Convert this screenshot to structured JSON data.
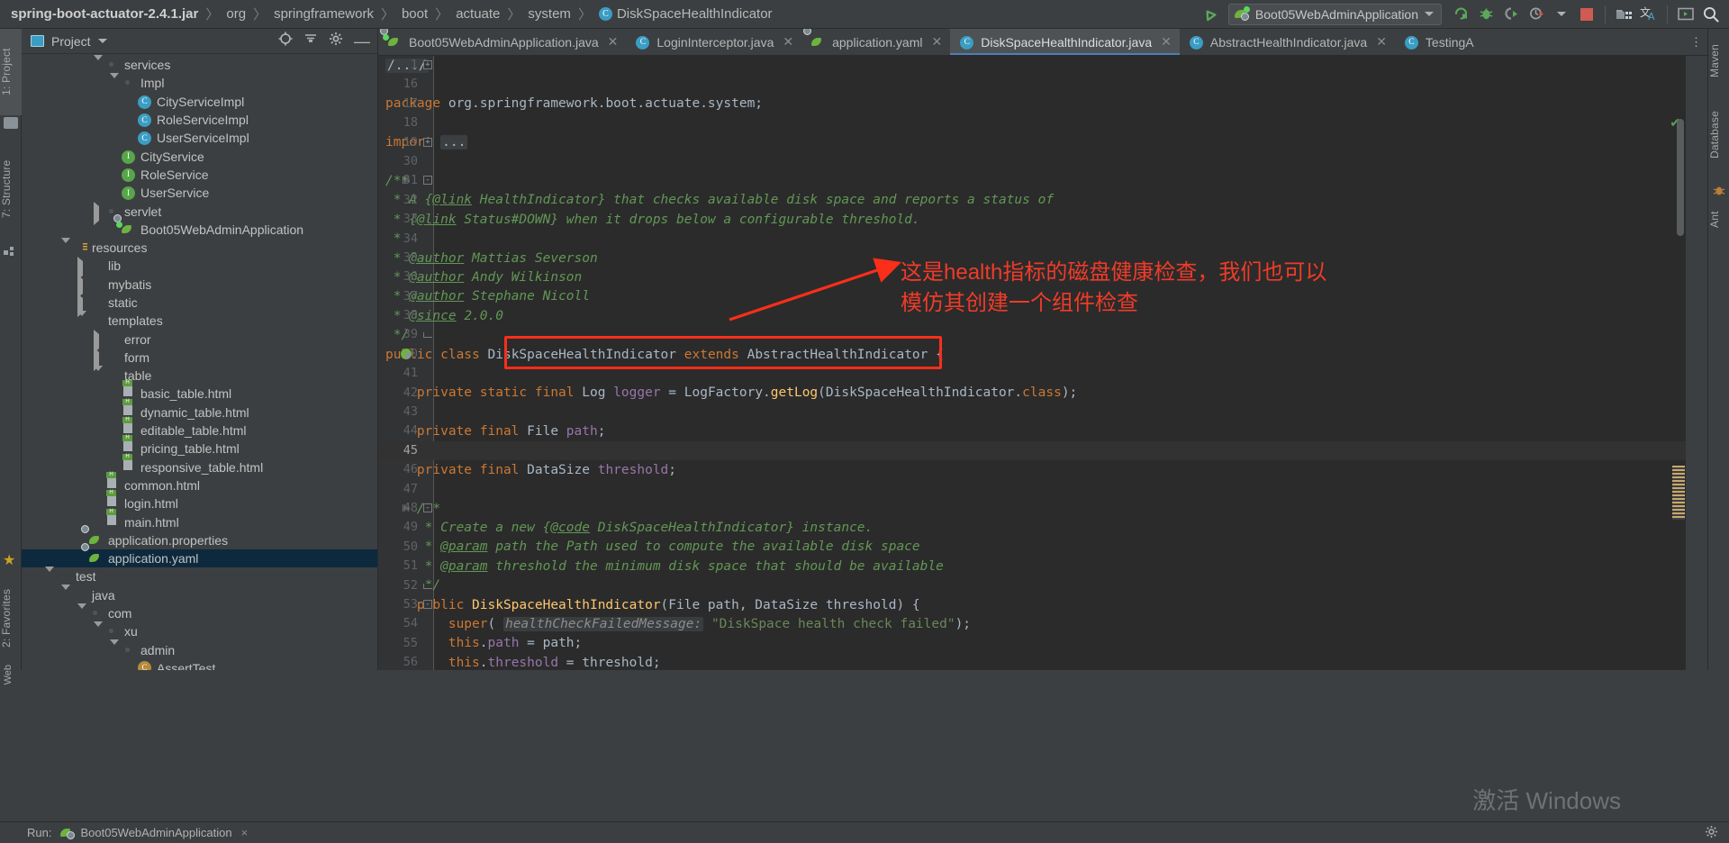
{
  "topbar": {
    "breadcrumbs": [
      {
        "label": "spring-boot-actuator-2.4.1.jar",
        "icon": "",
        "bold": true
      },
      {
        "label": "org",
        "icon": ""
      },
      {
        "label": "springframework",
        "icon": ""
      },
      {
        "label": "boot",
        "icon": ""
      },
      {
        "label": "actuate",
        "icon": ""
      },
      {
        "label": "system",
        "icon": ""
      },
      {
        "label": "DiskSpaceHealthIndicator",
        "icon": "class-icon"
      }
    ],
    "run_config": "Boot05WebAdminApplication",
    "icons": [
      "build-icon",
      "run-icon",
      "debug-icon",
      "run-coverage-icon",
      "profiler-icon",
      "stop-icon",
      "project-structure-icon",
      "translate-icon",
      "terminal-icon",
      "search-everywhere-icon"
    ]
  },
  "left_tool_strip": {
    "tabs": [
      "1: Project",
      "7: Structure"
    ],
    "active": "1: Project",
    "bottom_tabs": [
      "2: Favorites"
    ]
  },
  "right_tool_strip": {
    "tabs": [
      "Maven",
      "Database",
      "Ant"
    ]
  },
  "project_panel": {
    "title": "Project",
    "tree": [
      {
        "depth": 4,
        "twisty": "down",
        "icon": "folder-pkg",
        "label": "services"
      },
      {
        "depth": 5,
        "twisty": "down",
        "icon": "folder-pkg",
        "label": "Impl"
      },
      {
        "depth": 6,
        "twisty": "none",
        "icon": "class",
        "label": "CityServiceImpl"
      },
      {
        "depth": 6,
        "twisty": "none",
        "icon": "class",
        "label": "RoleServiceImpl"
      },
      {
        "depth": 6,
        "twisty": "none",
        "icon": "class",
        "label": "UserServiceImpl"
      },
      {
        "depth": 5,
        "twisty": "none",
        "icon": "interface",
        "label": "CityService"
      },
      {
        "depth": 5,
        "twisty": "none",
        "icon": "interface",
        "label": "RoleService"
      },
      {
        "depth": 5,
        "twisty": "none",
        "icon": "interface",
        "label": "UserService"
      },
      {
        "depth": 4,
        "twisty": "right",
        "icon": "folder-pkg",
        "label": "servlet"
      },
      {
        "depth": 5,
        "twisty": "none",
        "icon": "spring-boot",
        "label": "Boot05WebAdminApplication"
      },
      {
        "depth": 2,
        "twisty": "down",
        "icon": "folder-res",
        "label": "resources"
      },
      {
        "depth": 3,
        "twisty": "right",
        "icon": "folder",
        "label": "lib"
      },
      {
        "depth": 3,
        "twisty": "right",
        "icon": "folder",
        "label": "mybatis"
      },
      {
        "depth": 3,
        "twisty": "right",
        "icon": "folder",
        "label": "static"
      },
      {
        "depth": 3,
        "twisty": "down",
        "icon": "folder",
        "label": "templates"
      },
      {
        "depth": 4,
        "twisty": "right",
        "icon": "folder",
        "label": "error"
      },
      {
        "depth": 4,
        "twisty": "right",
        "icon": "folder",
        "label": "form"
      },
      {
        "depth": 4,
        "twisty": "down",
        "icon": "folder",
        "label": "table"
      },
      {
        "depth": 5,
        "twisty": "none",
        "icon": "html",
        "label": "basic_table.html"
      },
      {
        "depth": 5,
        "twisty": "none",
        "icon": "html",
        "label": "dynamic_table.html"
      },
      {
        "depth": 5,
        "twisty": "none",
        "icon": "html",
        "label": "editable_table.html"
      },
      {
        "depth": 5,
        "twisty": "none",
        "icon": "html",
        "label": "pricing_table.html"
      },
      {
        "depth": 5,
        "twisty": "none",
        "icon": "html",
        "label": "responsive_table.html"
      },
      {
        "depth": 4,
        "twisty": "none",
        "icon": "html",
        "label": "common.html"
      },
      {
        "depth": 4,
        "twisty": "none",
        "icon": "html",
        "label": "login.html"
      },
      {
        "depth": 4,
        "twisty": "none",
        "icon": "html",
        "label": "main.html"
      },
      {
        "depth": 3,
        "twisty": "none",
        "icon": "spring-prop",
        "label": "application.properties"
      },
      {
        "depth": 3,
        "twisty": "none",
        "icon": "spring-prop",
        "label": "application.yaml",
        "selected": true
      },
      {
        "depth": 1,
        "twisty": "down",
        "icon": "folder-test",
        "label": "test"
      },
      {
        "depth": 2,
        "twisty": "down",
        "icon": "folder-test",
        "label": "java"
      },
      {
        "depth": 3,
        "twisty": "down",
        "icon": "folder-pkg",
        "label": "com"
      },
      {
        "depth": 4,
        "twisty": "down",
        "icon": "folder-pkg",
        "label": "xu"
      },
      {
        "depth": 5,
        "twisty": "down",
        "icon": "folder-pkg",
        "label": "admin"
      },
      {
        "depth": 6,
        "twisty": "none",
        "icon": "test-class",
        "label": "AssertTest"
      }
    ]
  },
  "editor_tabs": [
    {
      "label": "Boot05WebAdminApplication.java",
      "icon": "spring-boot",
      "active": false,
      "closable": true
    },
    {
      "label": "LoginInterceptor.java",
      "icon": "class",
      "active": false,
      "closable": true
    },
    {
      "label": "application.yaml",
      "icon": "spring-prop",
      "active": false,
      "closable": true
    },
    {
      "label": "DiskSpaceHealthIndicator.java",
      "icon": "class",
      "active": true,
      "closable": true
    },
    {
      "label": "AbstractHealthIndicator.java",
      "icon": "class",
      "active": false,
      "closable": true
    },
    {
      "label": "TestingA",
      "icon": "class",
      "active": false,
      "closable": false
    }
  ],
  "code": {
    "file": "DiskSpaceHealthIndicator.java",
    "lines": [
      {
        "num": "1",
        "fold": "+",
        "tokens": [
          {
            "t": "/.../",
            "c": "pill"
          }
        ]
      },
      {
        "num": "16",
        "tokens": []
      },
      {
        "num": "17",
        "tokens": [
          {
            "t": "package ",
            "c": "k"
          },
          {
            "t": "org.springframework.boot.actuate.system;",
            "c": "id"
          }
        ]
      },
      {
        "num": "18",
        "tokens": []
      },
      {
        "num": "19",
        "fold": "+",
        "tokens": [
          {
            "t": "import ",
            "c": "k"
          },
          {
            "t": "...",
            "c": "pill"
          }
        ]
      },
      {
        "num": "30",
        "tokens": []
      },
      {
        "num": "31",
        "fold": "-",
        "bookmark": true,
        "tokens": [
          {
            "t": "/**",
            "c": "c"
          }
        ]
      },
      {
        "num": "32",
        "tokens": [
          {
            "t": " * A {",
            "c": "c"
          },
          {
            "t": "@link",
            "c": "tag"
          },
          {
            "t": " HealthIndicator} that checks available disk space and reports a status of",
            "c": "c"
          }
        ]
      },
      {
        "num": "33",
        "tokens": [
          {
            "t": " * {",
            "c": "c"
          },
          {
            "t": "@link",
            "c": "tag"
          },
          {
            "t": " Status#DOWN} when it drops below a configurable threshold.",
            "c": "c"
          }
        ]
      },
      {
        "num": "34",
        "tokens": [
          {
            "t": " *",
            "c": "c"
          }
        ]
      },
      {
        "num": "35",
        "tokens": [
          {
            "t": " * ",
            "c": "c"
          },
          {
            "t": "@author",
            "c": "tag"
          },
          {
            "t": " Mattias Severson",
            "c": "c"
          }
        ]
      },
      {
        "num": "36",
        "tokens": [
          {
            "t": " * ",
            "c": "c"
          },
          {
            "t": "@author",
            "c": "tag"
          },
          {
            "t": " Andy Wilkinson",
            "c": "c"
          }
        ]
      },
      {
        "num": "37",
        "tokens": [
          {
            "t": " * ",
            "c": "c"
          },
          {
            "t": "@author",
            "c": "tag"
          },
          {
            "t": " Stephane Nicoll",
            "c": "c"
          }
        ]
      },
      {
        "num": "38",
        "tokens": [
          {
            "t": " * ",
            "c": "c"
          },
          {
            "t": "@since",
            "c": "tag"
          },
          {
            "t": " 2.0.0",
            "c": "c"
          }
        ]
      },
      {
        "num": "39",
        "fold": "e",
        "tokens": [
          {
            "t": " */",
            "c": "c"
          }
        ]
      },
      {
        "num": "40",
        "runmark": true,
        "tokens": [
          {
            "t": "public class ",
            "c": "k"
          },
          {
            "t": "DiskSpaceHealthIndicator ",
            "c": "id"
          },
          {
            "t": "extends ",
            "c": "k"
          },
          {
            "t": "AbstractHealthIndicator ",
            "c": "id"
          },
          {
            "t": "{",
            "c": "id"
          }
        ]
      },
      {
        "num": "41",
        "tokens": []
      },
      {
        "num": "42",
        "tokens": [
          {
            "t": "    private static final ",
            "c": "k"
          },
          {
            "t": "Log ",
            "c": "id"
          },
          {
            "t": "logger",
            "c": "fld"
          },
          {
            "t": " = LogFactory.",
            "c": "id"
          },
          {
            "t": "getLog",
            "c": "mth"
          },
          {
            "t": "(DiskSpaceHealthIndicator.",
            "c": "id"
          },
          {
            "t": "class",
            "c": "k"
          },
          {
            "t": ");",
            "c": "id"
          }
        ]
      },
      {
        "num": "43",
        "tokens": []
      },
      {
        "num": "44",
        "tokens": [
          {
            "t": "    private final ",
            "c": "k"
          },
          {
            "t": "File ",
            "c": "id"
          },
          {
            "t": "path",
            "c": "fld"
          },
          {
            "t": ";",
            "c": "id"
          }
        ]
      },
      {
        "num": "45",
        "current": true,
        "tokens": []
      },
      {
        "num": "46",
        "tokens": [
          {
            "t": "    private final ",
            "c": "k"
          },
          {
            "t": "DataSize ",
            "c": "id"
          },
          {
            "t": "threshold",
            "c": "fld"
          },
          {
            "t": ";",
            "c": "id"
          }
        ]
      },
      {
        "num": "47",
        "tokens": []
      },
      {
        "num": "48",
        "fold": "-",
        "bookmark": true,
        "tokens": [
          {
            "t": "    /**",
            "c": "c"
          }
        ]
      },
      {
        "num": "49",
        "tokens": [
          {
            "t": "     * Create a new {",
            "c": "c"
          },
          {
            "t": "@code",
            "c": "tag"
          },
          {
            "t": " DiskSpaceHealthIndicator} instance.",
            "c": "c"
          }
        ]
      },
      {
        "num": "50",
        "tokens": [
          {
            "t": "     * ",
            "c": "c"
          },
          {
            "t": "@param",
            "c": "tag"
          },
          {
            "t": " path the Path used to compute the available disk space",
            "c": "c"
          }
        ]
      },
      {
        "num": "51",
        "tokens": [
          {
            "t": "     * ",
            "c": "c"
          },
          {
            "t": "@param",
            "c": "tag"
          },
          {
            "t": " threshold the minimum disk space that should be available",
            "c": "c"
          }
        ]
      },
      {
        "num": "52",
        "fold": "e",
        "tokens": [
          {
            "t": "     */",
            "c": "c"
          }
        ]
      },
      {
        "num": "53",
        "fold": "-",
        "tokens": [
          {
            "t": "    public ",
            "c": "k"
          },
          {
            "t": "DiskSpaceHealthIndicator",
            "c": "mth"
          },
          {
            "t": "(File path, DataSize threshold) {",
            "c": "id"
          }
        ]
      },
      {
        "num": "54",
        "tokens": [
          {
            "t": "        super",
            "c": "k"
          },
          {
            "t": "( ",
            "c": "id"
          },
          {
            "t": "healthCheckFailedMessage:",
            "c": "hint"
          },
          {
            "t": " ",
            "c": "id"
          },
          {
            "t": "\"DiskSpace health check failed\"",
            "c": "s"
          },
          {
            "t": ");",
            "c": "id"
          }
        ]
      },
      {
        "num": "55",
        "tokens": [
          {
            "t": "        this",
            "c": "k"
          },
          {
            "t": ".",
            "c": "id"
          },
          {
            "t": "path",
            "c": "fld"
          },
          {
            "t": " = path;",
            "c": "id"
          }
        ]
      },
      {
        "num": "56",
        "tokens": [
          {
            "t": "        this",
            "c": "k"
          },
          {
            "t": ".",
            "c": "id"
          },
          {
            "t": "threshold",
            "c": "fld"
          },
          {
            "t": " = threshold;",
            "c": "id"
          }
        ]
      }
    ]
  },
  "annotation": {
    "text": "这是health指标的磁盘健康检查，我们也可以\n模仿其创建一个组件检查",
    "color": "#f03b28",
    "highlight_box_target": "DiskSpaceHealthIndicator extends AbstractHealthIndicator {"
  },
  "status_bar": {
    "run_label": "Boot05WebAdminApplication",
    "run_tab_icon": "spring-boot"
  },
  "watermark": "激活 Windows"
}
